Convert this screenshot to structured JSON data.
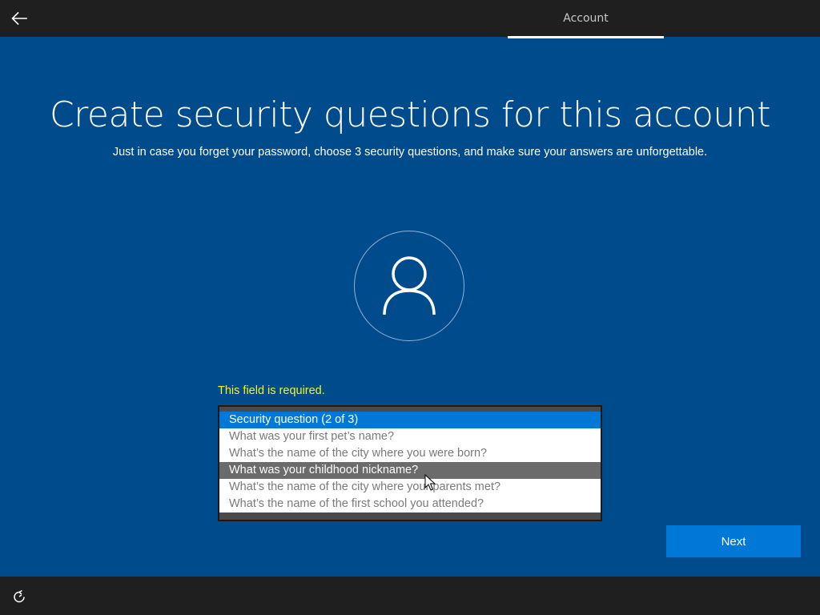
{
  "header": {
    "back_icon": "back-arrow-icon",
    "tab_label": "Account"
  },
  "main": {
    "title": "Create security questions for this account",
    "subtitle": "Just in case you forget your password, choose 3 security questions, and make sure your answers are unforgettable.",
    "avatar_icon": "user-icon",
    "error_text": "This field is required."
  },
  "dropdown": {
    "options": [
      {
        "label": "Security question (2 of 3)",
        "state": "selected"
      },
      {
        "label": "What was your first pet’s name?",
        "state": "normal"
      },
      {
        "label": "What’s the name of the city where you were born?",
        "state": "normal"
      },
      {
        "label": "What was your childhood nickname?",
        "state": "hovered"
      },
      {
        "label": "What’s the name of the city where your parents met?",
        "state": "normal"
      },
      {
        "label": "What’s the name of the first school you attended?",
        "state": "normal"
      }
    ]
  },
  "footer": {
    "next_label": "Next",
    "accessibility_icon": "ease-of-access-icon"
  },
  "colors": {
    "background": "#004b8c",
    "bars": "#1f1f1f",
    "accent": "#0078d7",
    "error": "#f5f51a",
    "hover": "#6b6b6b"
  }
}
